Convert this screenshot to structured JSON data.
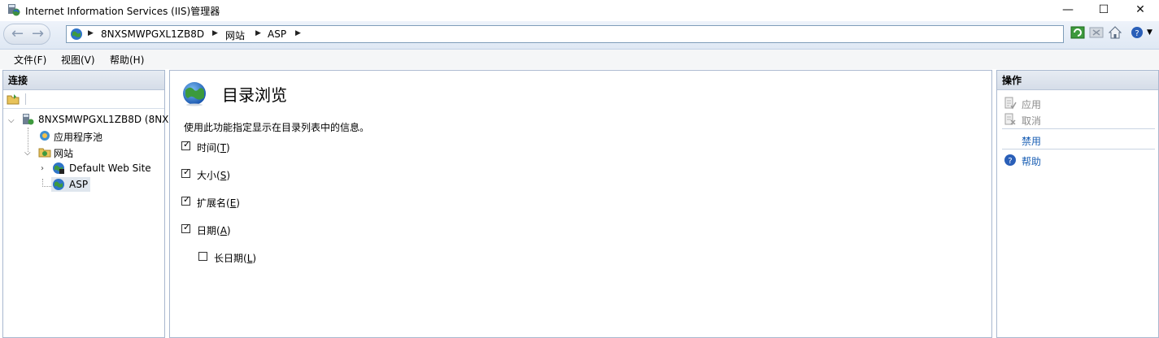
{
  "window": {
    "title": "Internet Information Services (IIS)管理器",
    "controls": {
      "minimize": "—",
      "maximize": "☐",
      "close": "✕"
    }
  },
  "address": {
    "crumbs": [
      "8NXSMWPGXL1ZB8D",
      "网站",
      "ASP"
    ]
  },
  "menu": [
    "文件(F)",
    "视图(V)",
    "帮助(H)"
  ],
  "connections": {
    "header": "连接",
    "tree": [
      {
        "label": "8NXSMWPGXL1ZB8D (8NX",
        "icon": "server-icon",
        "expanded": true
      },
      {
        "label": "应用程序池",
        "icon": "app-pool-icon"
      },
      {
        "label": "网站",
        "icon": "sites-folder-icon",
        "expanded": true
      },
      {
        "label": "Default Web Site",
        "icon": "website-globe-icon",
        "expanded": false
      },
      {
        "label": "ASP",
        "icon": "app-globe-icon",
        "selected": true
      }
    ]
  },
  "main": {
    "title": "目录浏览",
    "description": "使用此功能指定显示在目录列表中的信息。",
    "options": [
      {
        "label": "时间",
        "hotkey": "T",
        "checked": true
      },
      {
        "label": "大小",
        "hotkey": "S",
        "checked": true
      },
      {
        "label": "扩展名",
        "hotkey": "E",
        "checked": true
      },
      {
        "label": "日期",
        "hotkey": "A",
        "checked": true
      },
      {
        "label": "长日期",
        "hotkey": "L",
        "checked": false
      }
    ]
  },
  "actions": {
    "header": "操作",
    "items": [
      {
        "label": "应用",
        "enabled": false,
        "icon": "apply-icon"
      },
      {
        "label": "取消",
        "enabled": false,
        "icon": "cancel-icon"
      },
      {
        "label": "禁用",
        "enabled": true,
        "icon": ""
      },
      {
        "label": "帮助",
        "enabled": true,
        "icon": "help-icon"
      }
    ]
  },
  "colors": {
    "link": "#1a5fb4",
    "disabled": "#8c8c8c",
    "selection": "#dfe6ee"
  }
}
